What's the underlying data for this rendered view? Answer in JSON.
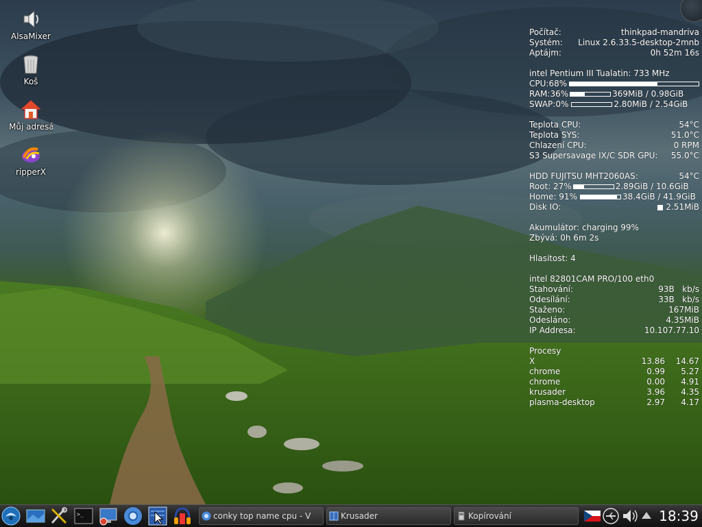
{
  "desktop": {
    "icons": [
      {
        "label": "AlsaMixer",
        "icon": "speaker-icon"
      },
      {
        "label": "Koš",
        "icon": "trash-icon"
      },
      {
        "label": "Můj adresář",
        "icon": "home-icon"
      },
      {
        "label": "ripperX",
        "icon": "ripperx-icon"
      }
    ]
  },
  "conky": {
    "system": [
      {
        "label": "Počítač:",
        "value": "thinkpad-mandriva"
      },
      {
        "label": "Systém:",
        "value": "Linux 2.6.33.5-desktop-2mnb"
      },
      {
        "label": "Aptájm:",
        "value": "0h 52m 16s"
      }
    ],
    "cpu_model": "intel Pentium III Tualatin: 733 MHz",
    "cpu": {
      "label": "CPU:68%",
      "level": 0.68
    },
    "ram": {
      "label": "RAM:36%",
      "level": 0.36,
      "value": "369MiB / 0.98GiB"
    },
    "swap": {
      "label": "SWAP:0%",
      "level": 0.0,
      "value": "2.80MiB / 2.54GiB"
    },
    "temps": [
      {
        "label": "Teplota CPU:",
        "value": "54°C"
      },
      {
        "label": "Teplota SYS:",
        "value": "51.0°C"
      },
      {
        "label": "Chlazení CPU:",
        "value": "0 RPM"
      },
      {
        "label": "S3 Supersavage IX/C SDR GPU:",
        "value": "55.0°C"
      }
    ],
    "hdd": {
      "label": "HDD FUJITSU MHT2060AS:",
      "value": "54°C"
    },
    "root": {
      "label": "Root:  27%",
      "level": 0.27,
      "value": "2.89GiB / 10.6GiB"
    },
    "home": {
      "label": "Home: 91%",
      "level": 0.91,
      "value": "38.4GiB / 41.9GiB"
    },
    "diskio": {
      "label": "Disk IO:",
      "value": "2.51MiB"
    },
    "battery": {
      "line1": "Akumulátor: charging 99%",
      "line2": "Zbývá: 0h 6m 2s"
    },
    "volume": "Hlasitost: 4",
    "net": {
      "adapter": "intel 82801CAM PRO/100 eth0",
      "rows": [
        {
          "label": "Stahování:",
          "value": "93B   kb/s"
        },
        {
          "label": "Odesílání:",
          "value": "33B   kb/s"
        },
        {
          "label": "Staženo:",
          "value": "167MiB"
        },
        {
          "label": "Odesláno:",
          "value": "4.35MiB"
        },
        {
          "label": "IP Addresa:",
          "value": "10.107.77.10"
        }
      ]
    },
    "processes": {
      "title": "Procesy",
      "rows": [
        {
          "name": "X",
          "a": "13.86",
          "b": "14.67"
        },
        {
          "name": "chrome",
          "a": "0.99",
          "b": "5.27"
        },
        {
          "name": "chrome",
          "a": "0.00",
          "b": "4.91"
        },
        {
          "name": "krusader",
          "a": "3.96",
          "b": "4.35"
        },
        {
          "name": "plasma-desktop",
          "a": "2.97",
          "b": "4.17"
        }
      ]
    }
  },
  "taskbar": {
    "launchers": [
      "kickoff-menu-icon",
      "desktop-icon",
      "tools-icon",
      "terminal-icon",
      "monitor-icon",
      "chromium-icon",
      "screenshot-icon",
      "audio-headphones-icon"
    ],
    "tasks": [
      {
        "label": "conky top name cpu - V",
        "icon": "chromium-icon"
      },
      {
        "label": "Krusader",
        "icon": "krusader-icon"
      },
      {
        "label": "Kopírování",
        "icon": "copy-icon"
      }
    ],
    "tray": [
      "czech-flag-icon",
      "usb-icon",
      "volume-icon",
      "up-arrow-icon"
    ],
    "clock": "18:39"
  },
  "colors": {
    "taskbar": "#1c1c1c",
    "text": "#ffffff"
  }
}
